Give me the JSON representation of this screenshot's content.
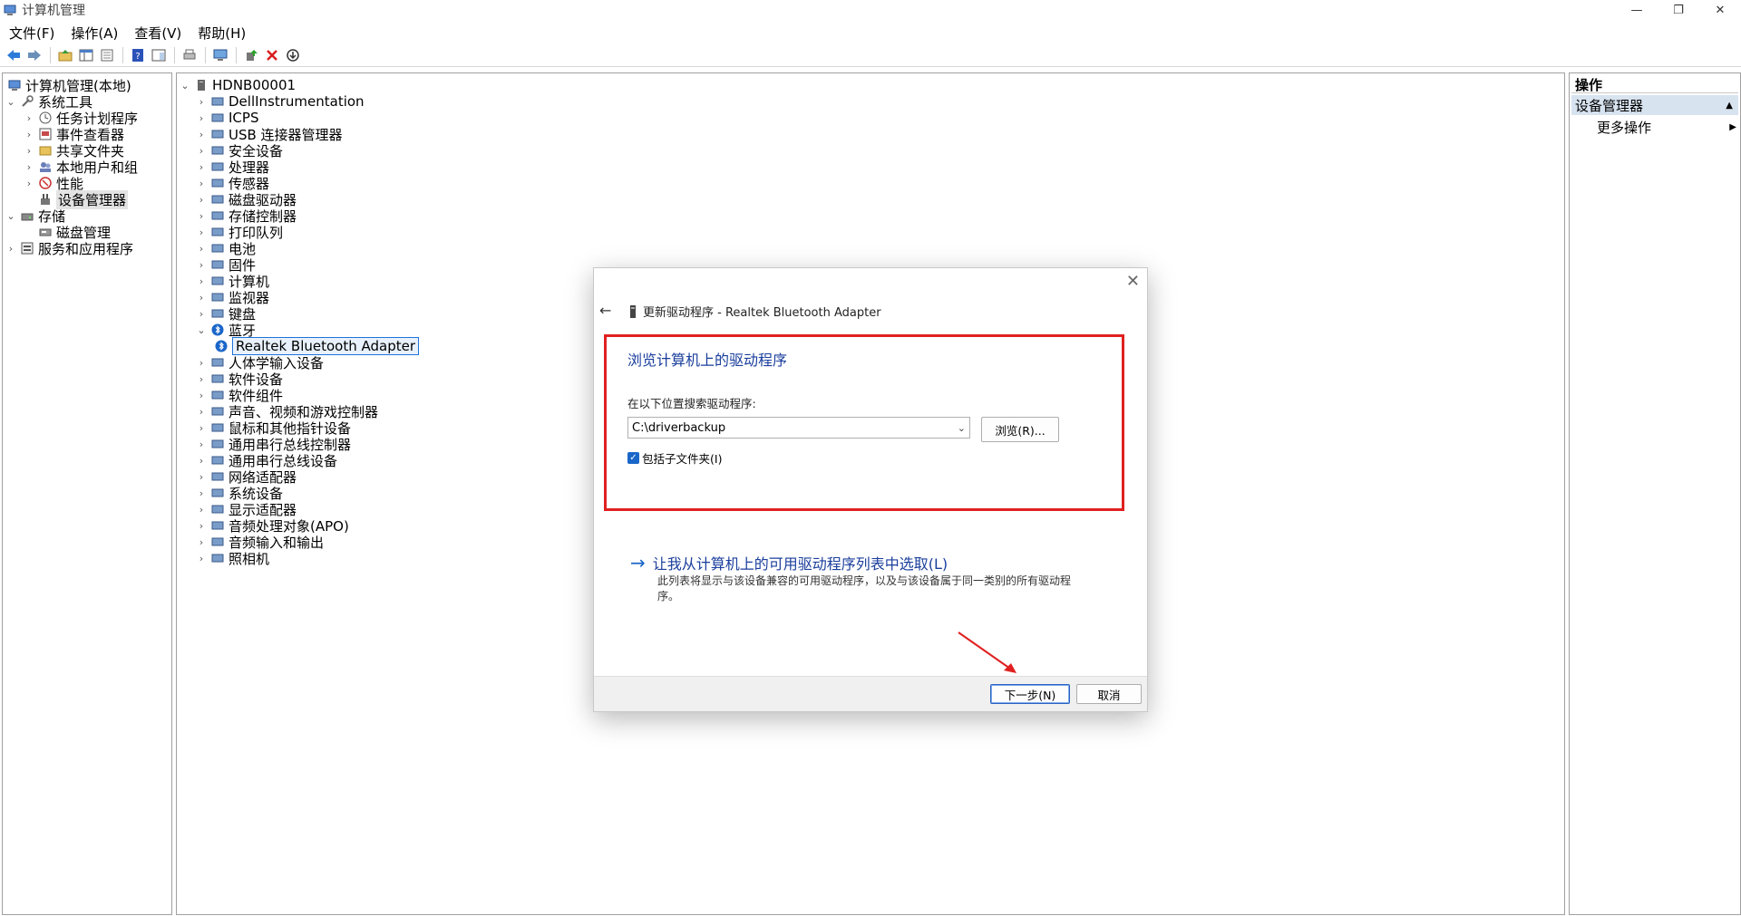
{
  "window": {
    "title": "计算机管理",
    "controls": [
      "—",
      "❐",
      "✕"
    ]
  },
  "menu": [
    "文件(F)",
    "操作(A)",
    "查看(V)",
    "帮助(H)"
  ],
  "left_tree": [
    {
      "label": "计算机管理(本地)",
      "icon": "computer-management-icon"
    },
    {
      "label": "系统工具",
      "icon": "tools-icon"
    },
    {
      "label": "任务计划程序",
      "icon": "clock-icon"
    },
    {
      "label": "事件查看器",
      "icon": "event-viewer-icon"
    },
    {
      "label": "共享文件夹",
      "icon": "shared-folder-icon"
    },
    {
      "label": "本地用户和组",
      "icon": "users-icon"
    },
    {
      "label": "性能",
      "icon": "performance-icon"
    },
    {
      "label": "设备管理器",
      "icon": "device-manager-icon"
    },
    {
      "label": "存储",
      "icon": "storage-icon"
    },
    {
      "label": "磁盘管理",
      "icon": "disk-management-icon"
    },
    {
      "label": "服务和应用程序",
      "icon": "services-icon"
    }
  ],
  "device_tree": {
    "root": "HDNB00001",
    "categories": [
      "DellInstrumentation",
      "ICPS",
      "USB 连接器管理器",
      "安全设备",
      "处理器",
      "传感器",
      "磁盘驱动器",
      "存储控制器",
      "打印队列",
      "电池",
      "固件",
      "计算机",
      "监视器",
      "键盘",
      "蓝牙",
      "人体学输入设备",
      "软件设备",
      "软件组件",
      "声音、视频和游戏控制器",
      "鼠标和其他指针设备",
      "通用串行总线控制器",
      "通用串行总线设备",
      "网络适配器",
      "系统设备",
      "显示适配器",
      "音频处理对象(APO)",
      "音频输入和输出",
      "照相机"
    ],
    "expanded_child": "Realtek Bluetooth Adapter"
  },
  "actions": {
    "header": "操作",
    "section": "设备管理器",
    "more": "更多操作"
  },
  "dialog": {
    "title": "更新驱动程序 - Realtek Bluetooth Adapter",
    "heading": "浏览计算机上的驱动程序",
    "search_label": "在以下位置搜索驱动程序:",
    "path_value": "C:\\driverbackup",
    "browse_label": "浏览(R)...",
    "subfolder_label": "包括子文件夹(I)",
    "subfolder_checked": true,
    "pick_link": "让我从计算机上的可用驱动程序列表中选取(L)",
    "pick_desc": "此列表将显示与该设备兼容的可用驱动程序，以及与该设备属于同一类别的所有驱动程序。",
    "next_label": "下一步(N)",
    "cancel_label": "取消"
  },
  "colors": {
    "accent": "#1a66c9",
    "heading_blue": "#1a3e9c",
    "highlight_red": "#e02020",
    "selection_bg": "#e3e3e3"
  }
}
